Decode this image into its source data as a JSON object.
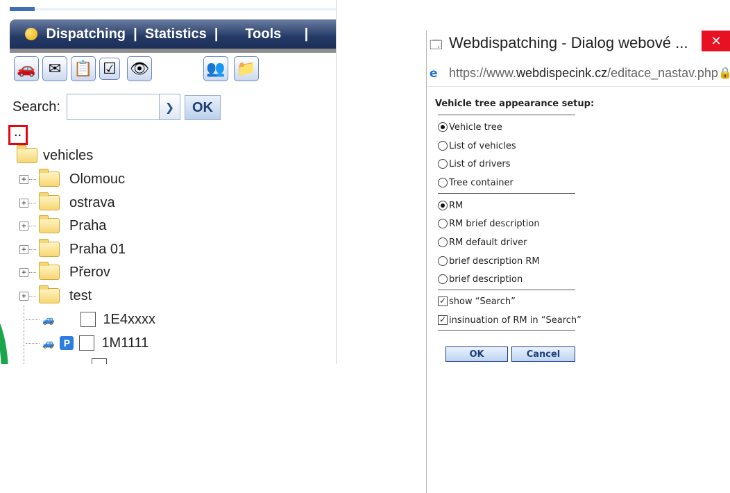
{
  "left": {
    "menu": [
      " Dispatching ",
      " | ",
      " Statistics ",
      " |       ",
      "Tools",
      "      |"
    ],
    "search_label": "Search:",
    "search_value": "",
    "search_button": "OK",
    "collapse_label": "··",
    "tree": {
      "root": "vehicles",
      "folders": [
        "Olomouc",
        "ostrava",
        "Praha",
        "Praha 01",
        "Přerov",
        "test"
      ],
      "vehicles": [
        {
          "name": "1E4xxxx",
          "parked": false
        },
        {
          "name": "1M1111",
          "parked": true,
          "badge": "P"
        }
      ]
    },
    "accent_color": "#1c2f58",
    "highlight_color": "#e30613"
  },
  "dialog": {
    "title": "Webdispatching - Dialog webové ...",
    "close_glyph": "✕",
    "url_prefix": "https://www.",
    "url_domain": "webdispecink.cz",
    "url_path": "/editace_nastav.php",
    "heading": "Vehicle tree appearance setup:",
    "group1": [
      {
        "label": "Vehicle tree",
        "selected": true
      },
      {
        "label": "List of vehicles",
        "selected": false
      },
      {
        "label": "List of drivers",
        "selected": false
      },
      {
        "label": "Tree container",
        "selected": false
      }
    ],
    "group2": [
      {
        "label": "RM",
        "selected": true
      },
      {
        "label": "RM brief description",
        "selected": false
      },
      {
        "label": "RM default driver",
        "selected": false
      },
      {
        "label": "brief description RM",
        "selected": false
      },
      {
        "label": "brief description",
        "selected": false
      }
    ],
    "checks": [
      {
        "label": "show “Search”",
        "checked": true
      },
      {
        "label": "insinuation of RM in “Search”",
        "checked": true
      }
    ],
    "ok": "OK",
    "cancel": "Cancel"
  },
  "icons": [
    "vehicle-query-icon",
    "vehicle-mail-icon",
    "vehicle-list-icon",
    "checklist-icon",
    "vehicle-view-icon",
    "contacts-mail-icon",
    "new-folder-icon"
  ]
}
